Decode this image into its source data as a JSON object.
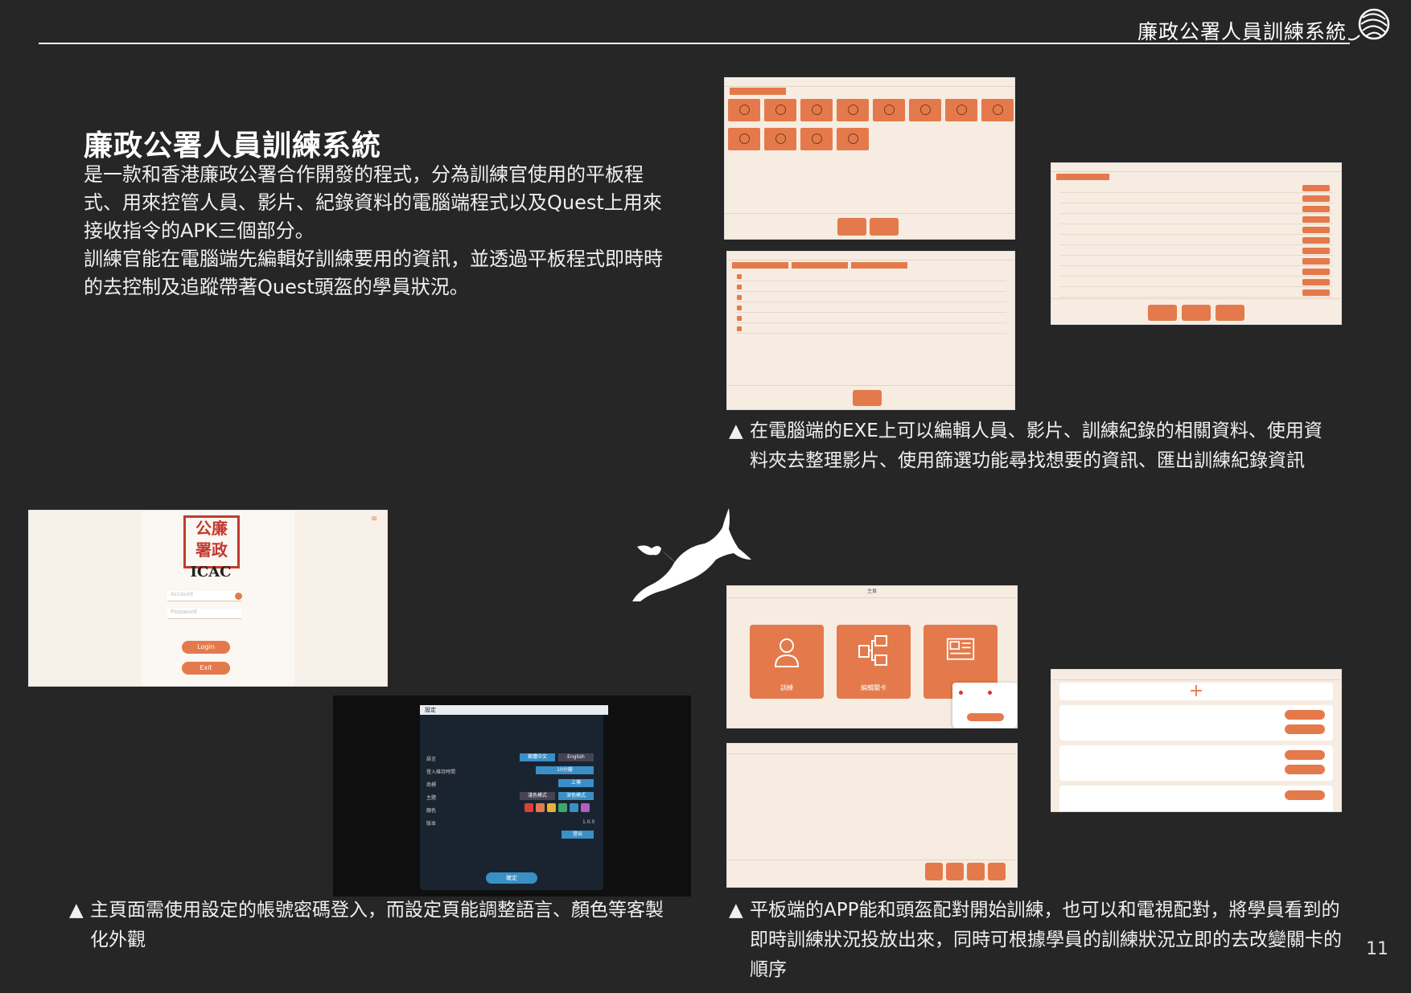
{
  "header": {
    "brand": "廉政公署人員訓練系統"
  },
  "intro": {
    "title": "廉政公署人員訓練系統",
    "para1": "是一款和香港廉政公署合作開發的程式，分為訓練官使用的平板程式、用來控管人員、影片、紀錄資料的電腦端程式以及Quest上用來接收指令的APK三個部分。",
    "para2": "訓練官能在電腦端先編輯好訓練要用的資訊，並透過平板程式即時時的去控制及追蹤帶著Quest頭盔的學員狀況。"
  },
  "captions": {
    "exe": "在電腦端的EXE上可以編輯人員、影片、訓練紀錄的相關資料、使用資料夾去整理影片、使用篩選功能尋找想要的資訊、匯出訓練紀錄資訊",
    "login": "主頁面需使用設定的帳號密碼登入，而設定頁能調整語言、顏色等客製化外觀",
    "tablet": "平板端的APP能和頭盔配對開始訓練，也可以和電視配對，將學員看到的即時訓練狀況投放出來，同時可根據學員的訓練狀況立即的去改變關卡的順序",
    "marker": "▲"
  },
  "screens": {
    "login": {
      "seal_top": "公廉",
      "seal_bottom": "署政",
      "org": "ICAC",
      "user_placeholder": "Account",
      "pass_placeholder": "Password",
      "login_btn": "Login",
      "exit_btn": "Exit"
    },
    "settings": {
      "title": "設定",
      "lang1": "繁體中文",
      "lang2": "English",
      "lang_label": "語言",
      "auto_label": "登入維持時間",
      "auto_value": "10分鐘",
      "upload_label": "商標",
      "upload_btn": "上傳",
      "theme_label": "主題",
      "theme_light": "淺色模式",
      "theme_dark": "深色模式",
      "color_label": "顏色",
      "version_label": "版本",
      "version": "1.0.0",
      "logout": "登出",
      "confirm": "確定"
    },
    "menu": {
      "title": "主頁",
      "train": "訓練",
      "edit": "編輯關卡",
      "record": "紀錄"
    }
  },
  "colors": {
    "bg": "#262626",
    "accent": "#e47a4b",
    "panel": "#f6ece2"
  },
  "page": {
    "number": "11"
  }
}
